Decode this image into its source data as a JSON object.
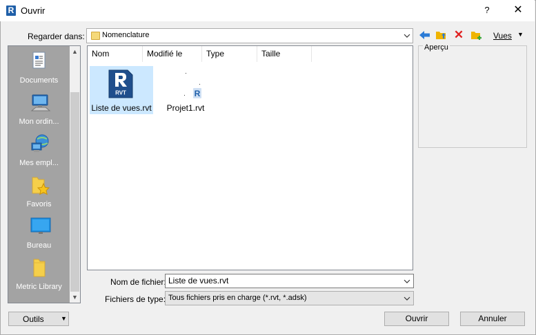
{
  "window": {
    "title": "Ouvrir",
    "help": "?",
    "close": "✕"
  },
  "look_in": {
    "label": "Regarder dans:",
    "value": "Nomenclature"
  },
  "toolbar": {
    "views_label": "Vues",
    "views_arrow": "▼",
    "delete": "✕"
  },
  "places": [
    {
      "label": "Documents",
      "icon": "documents-icon"
    },
    {
      "label": "Mon ordin...",
      "icon": "computer-icon"
    },
    {
      "label": "Mes empl...",
      "icon": "network-places-icon"
    },
    {
      "label": "Favoris",
      "icon": "favorites-icon"
    },
    {
      "label": "Bureau",
      "icon": "desktop-icon"
    },
    {
      "label": "Metric Library",
      "icon": "folder-icon"
    }
  ],
  "columns": {
    "name": "Nom",
    "modified": "Modifié le",
    "type": "Type",
    "size": "Taille"
  },
  "files": [
    {
      "name": "Liste de vues.rvt",
      "badge": "RVT",
      "selected": true
    },
    {
      "name": "Projet1.rvt",
      "badge": "R",
      "selected": false
    }
  ],
  "preview": {
    "label": "Aperçu"
  },
  "filename": {
    "label": "Nom de fichier:",
    "value": "Liste de vues.rvt"
  },
  "filetype": {
    "label": "Fichiers de type:",
    "value": "Tous fichiers pris en charge  (*.rvt, *.adsk)"
  },
  "buttons": {
    "tools": "Outils",
    "open": "Ouvrir",
    "cancel": "Annuler"
  },
  "scroll": {
    "up": "▲",
    "down": "▼"
  },
  "colors": {
    "accent": "#1f5fa8",
    "selection": "#cce8ff",
    "places_bg": "#a3a3a3"
  }
}
